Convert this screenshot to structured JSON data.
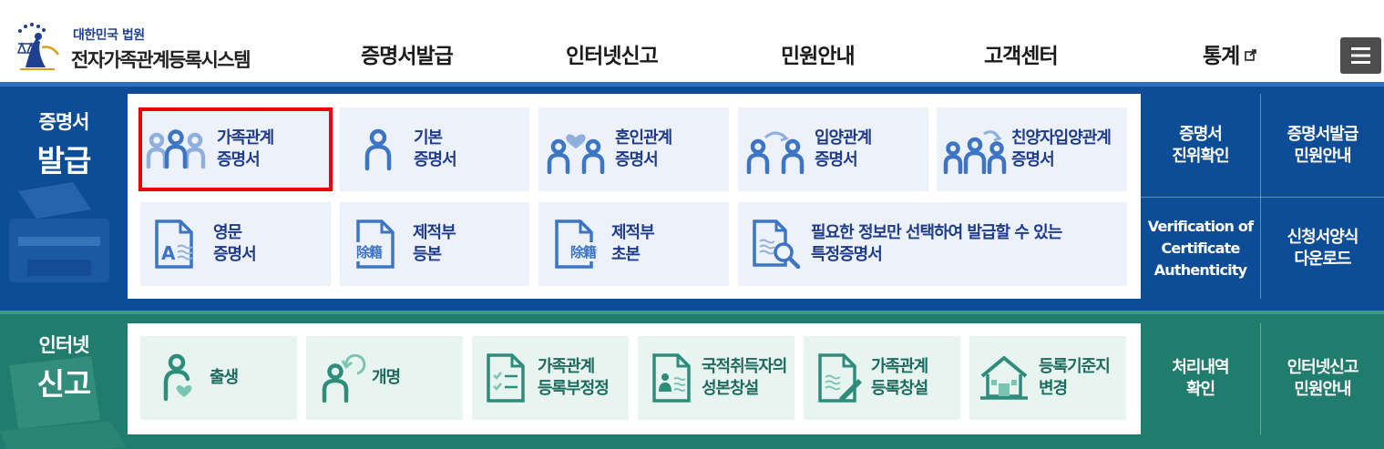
{
  "header": {
    "logo_small": "대한민국 법원",
    "logo_big": "전자가족관계등록시스템",
    "nav": [
      {
        "label": "증명서발급",
        "icon": "none"
      },
      {
        "label": "인터넷신고",
        "icon": "none"
      },
      {
        "label": "민원안내",
        "icon": "none"
      },
      {
        "label": "고객센터",
        "icon": "none"
      },
      {
        "label": "통계",
        "icon": "external-link-icon"
      }
    ],
    "menu_icon": "hamburger-icon"
  },
  "certificate": {
    "title_line1": "증명서",
    "title_line2": "발급",
    "cards": [
      {
        "label": "가족관계\n증명서",
        "icon": "family-three-icon"
      },
      {
        "label": "기본\n증명서",
        "icon": "person-icon"
      },
      {
        "label": "혼인관계\n증명서",
        "icon": "couple-heart-icon"
      },
      {
        "label": "입양관계\n증명서",
        "icon": "adoption-icon"
      },
      {
        "label": "친양자입양관계\n증명서",
        "icon": "full-adoption-icon"
      },
      {
        "label": "영문\n증명서",
        "icon": "english-document-icon"
      },
      {
        "label": "제적부\n등본",
        "icon": "removed-register-document-icon",
        "glyph": "除籍"
      },
      {
        "label": "제적부\n초본",
        "icon": "removed-register-extract-icon",
        "glyph": "除籍"
      },
      {
        "label": "필요한 정보만 선택하여 발급할 수 있는\n특정증명서",
        "icon": "document-search-icon"
      }
    ],
    "side": [
      {
        "label": "증명서\n진위확인"
      },
      {
        "label": "증명서발급\n민원안내"
      },
      {
        "label": "Verification of\nCertificate\nAuthenticity"
      },
      {
        "label": "신청서양식\n다운로드"
      }
    ]
  },
  "report": {
    "title_line1": "인터넷",
    "title_line2": "신고",
    "cards": [
      {
        "label": "출생",
        "icon": "birth-icon"
      },
      {
        "label": "개명",
        "icon": "rename-icon"
      },
      {
        "label": "가족관계\n등록부정정",
        "icon": "checklist-document-icon"
      },
      {
        "label": "국적취득자의\n성본창설",
        "icon": "naturalization-document-icon"
      },
      {
        "label": "가족관계\n등록창설",
        "icon": "document-pen-icon"
      },
      {
        "label": "등록기준지\n변경",
        "icon": "house-icon"
      }
    ],
    "side": [
      {
        "label": "처리내역\n확인"
      },
      {
        "label": "인터넷신고\n민원안내"
      }
    ]
  },
  "colors": {
    "blue_section": "#0d4c97",
    "green_section": "#207c6d",
    "blue_text": "#1f3c8c",
    "green_text": "#1d6b5e",
    "highlight": "#e00000"
  }
}
